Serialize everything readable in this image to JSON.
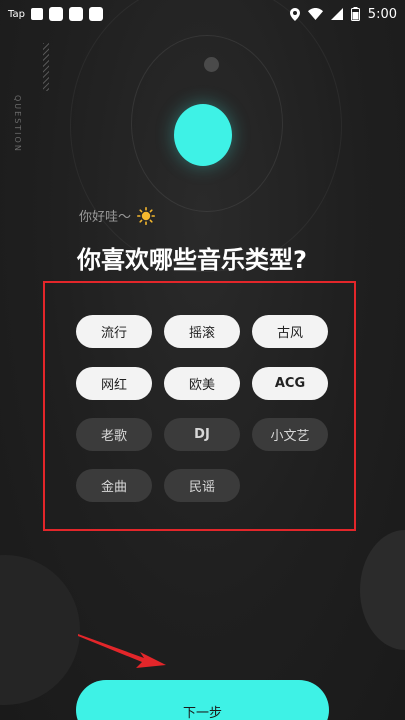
{
  "status_bar": {
    "app_label": "Tap",
    "time": "5:00"
  },
  "side_label": "QUESTION",
  "greeting": "你好哇～",
  "title": "你喜欢哪些音乐类型?",
  "genres": [
    {
      "label": "流行",
      "selected": true
    },
    {
      "label": "摇滚",
      "selected": true
    },
    {
      "label": "古风",
      "selected": true
    },
    {
      "label": "网红",
      "selected": true
    },
    {
      "label": "欧美",
      "selected": true
    },
    {
      "label": "ACG",
      "selected": true
    },
    {
      "label": "老歌",
      "selected": false
    },
    {
      "label": "DJ",
      "selected": false
    },
    {
      "label": "小文艺",
      "selected": false
    },
    {
      "label": "金曲",
      "selected": false
    },
    {
      "label": "民谣",
      "selected": false
    }
  ],
  "next_button_label": "下一步",
  "colors": {
    "accent": "#3ef2e6",
    "highlight_border": "#e3262a",
    "background": "#1e1e1e"
  }
}
